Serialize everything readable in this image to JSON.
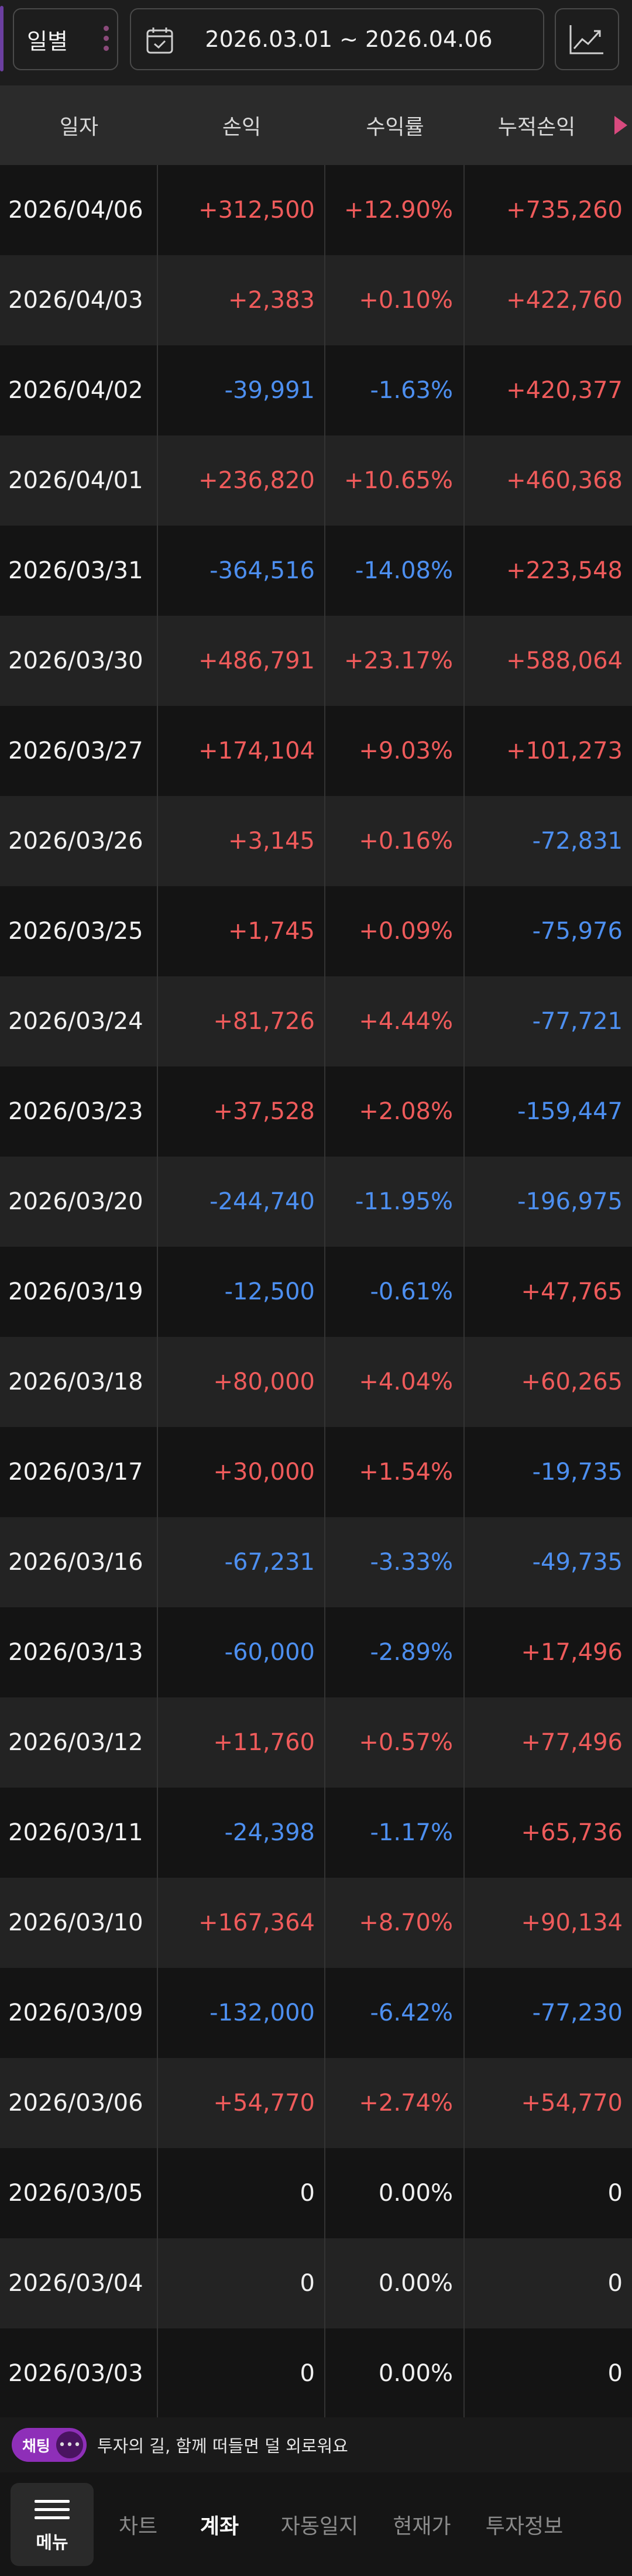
{
  "filter": {
    "period_label": "일별",
    "date_range": "2026.03.01 ~ 2026.04.06"
  },
  "table": {
    "headers": [
      "일자",
      "손익",
      "수익률",
      "누적손익"
    ],
    "rows": [
      {
        "date": "2026/04/06",
        "pnl": "+312,500",
        "rate": "+12.90%",
        "cum": "+735,260",
        "pnl_sign": "pos",
        "rate_sign": "pos",
        "cum_sign": "pos"
      },
      {
        "date": "2026/04/03",
        "pnl": "+2,383",
        "rate": "+0.10%",
        "cum": "+422,760",
        "pnl_sign": "pos",
        "rate_sign": "pos",
        "cum_sign": "pos"
      },
      {
        "date": "2026/04/02",
        "pnl": "-39,991",
        "rate": "-1.63%",
        "cum": "+420,377",
        "pnl_sign": "neg",
        "rate_sign": "neg",
        "cum_sign": "pos"
      },
      {
        "date": "2026/04/01",
        "pnl": "+236,820",
        "rate": "+10.65%",
        "cum": "+460,368",
        "pnl_sign": "pos",
        "rate_sign": "pos",
        "cum_sign": "pos"
      },
      {
        "date": "2026/03/31",
        "pnl": "-364,516",
        "rate": "-14.08%",
        "cum": "+223,548",
        "pnl_sign": "neg",
        "rate_sign": "neg",
        "cum_sign": "pos"
      },
      {
        "date": "2026/03/30",
        "pnl": "+486,791",
        "rate": "+23.17%",
        "cum": "+588,064",
        "pnl_sign": "pos",
        "rate_sign": "pos",
        "cum_sign": "pos"
      },
      {
        "date": "2026/03/27",
        "pnl": "+174,104",
        "rate": "+9.03%",
        "cum": "+101,273",
        "pnl_sign": "pos",
        "rate_sign": "pos",
        "cum_sign": "pos"
      },
      {
        "date": "2026/03/26",
        "pnl": "+3,145",
        "rate": "+0.16%",
        "cum": "-72,831",
        "pnl_sign": "pos",
        "rate_sign": "pos",
        "cum_sign": "neg"
      },
      {
        "date": "2026/03/25",
        "pnl": "+1,745",
        "rate": "+0.09%",
        "cum": "-75,976",
        "pnl_sign": "pos",
        "rate_sign": "pos",
        "cum_sign": "neg"
      },
      {
        "date": "2026/03/24",
        "pnl": "+81,726",
        "rate": "+4.44%",
        "cum": "-77,721",
        "pnl_sign": "pos",
        "rate_sign": "pos",
        "cum_sign": "neg"
      },
      {
        "date": "2026/03/23",
        "pnl": "+37,528",
        "rate": "+2.08%",
        "cum": "-159,447",
        "pnl_sign": "pos",
        "rate_sign": "pos",
        "cum_sign": "neg"
      },
      {
        "date": "2026/03/20",
        "pnl": "-244,740",
        "rate": "-11.95%",
        "cum": "-196,975",
        "pnl_sign": "neg",
        "rate_sign": "neg",
        "cum_sign": "neg"
      },
      {
        "date": "2026/03/19",
        "pnl": "-12,500",
        "rate": "-0.61%",
        "cum": "+47,765",
        "pnl_sign": "neg",
        "rate_sign": "neg",
        "cum_sign": "pos"
      },
      {
        "date": "2026/03/18",
        "pnl": "+80,000",
        "rate": "+4.04%",
        "cum": "+60,265",
        "pnl_sign": "pos",
        "rate_sign": "pos",
        "cum_sign": "pos"
      },
      {
        "date": "2026/03/17",
        "pnl": "+30,000",
        "rate": "+1.54%",
        "cum": "-19,735",
        "pnl_sign": "pos",
        "rate_sign": "pos",
        "cum_sign": "neg"
      },
      {
        "date": "2026/03/16",
        "pnl": "-67,231",
        "rate": "-3.33%",
        "cum": "-49,735",
        "pnl_sign": "neg",
        "rate_sign": "neg",
        "cum_sign": "neg"
      },
      {
        "date": "2026/03/13",
        "pnl": "-60,000",
        "rate": "-2.89%",
        "cum": "+17,496",
        "pnl_sign": "neg",
        "rate_sign": "neg",
        "cum_sign": "pos"
      },
      {
        "date": "2026/03/12",
        "pnl": "+11,760",
        "rate": "+0.57%",
        "cum": "+77,496",
        "pnl_sign": "pos",
        "rate_sign": "pos",
        "cum_sign": "pos"
      },
      {
        "date": "2026/03/11",
        "pnl": "-24,398",
        "rate": "-1.17%",
        "cum": "+65,736",
        "pnl_sign": "neg",
        "rate_sign": "neg",
        "cum_sign": "pos"
      },
      {
        "date": "2026/03/10",
        "pnl": "+167,364",
        "rate": "+8.70%",
        "cum": "+90,134",
        "pnl_sign": "pos",
        "rate_sign": "pos",
        "cum_sign": "pos"
      },
      {
        "date": "2026/03/09",
        "pnl": "-132,000",
        "rate": "-6.42%",
        "cum": "-77,230",
        "pnl_sign": "neg",
        "rate_sign": "neg",
        "cum_sign": "neg"
      },
      {
        "date": "2026/03/06",
        "pnl": "+54,770",
        "rate": "+2.74%",
        "cum": "+54,770",
        "pnl_sign": "pos",
        "rate_sign": "pos",
        "cum_sign": "pos"
      },
      {
        "date": "2026/03/05",
        "pnl": "0",
        "rate": "0.00%",
        "cum": "0",
        "pnl_sign": "zero",
        "rate_sign": "zero",
        "cum_sign": "zero"
      },
      {
        "date": "2026/03/04",
        "pnl": "0",
        "rate": "0.00%",
        "cum": "0",
        "pnl_sign": "zero",
        "rate_sign": "zero",
        "cum_sign": "zero"
      },
      {
        "date": "2026/03/03",
        "pnl": "0",
        "rate": "0.00%",
        "cum": "0",
        "pnl_sign": "zero",
        "rate_sign": "zero",
        "cum_sign": "zero"
      }
    ]
  },
  "chat": {
    "badge": "채팅",
    "message": "투자의 길, 함께 떠들면 덜 외로워요"
  },
  "nav": {
    "menu_label": "메뉴",
    "items": [
      "차트",
      "계좌",
      "자동일지",
      "현재가",
      "투자정보"
    ],
    "active_index": 1
  },
  "colors": {
    "positive": "#ef5b5b",
    "negative": "#4d8ff0",
    "chat_accent": "#8e2fb8"
  },
  "icons": {
    "date_range": "calendar-icon",
    "chart_button": "line-chart-icon",
    "header_more": "scroll-right-icon",
    "menu": "hamburger-icon",
    "chat": "chat-bubble-icon"
  }
}
